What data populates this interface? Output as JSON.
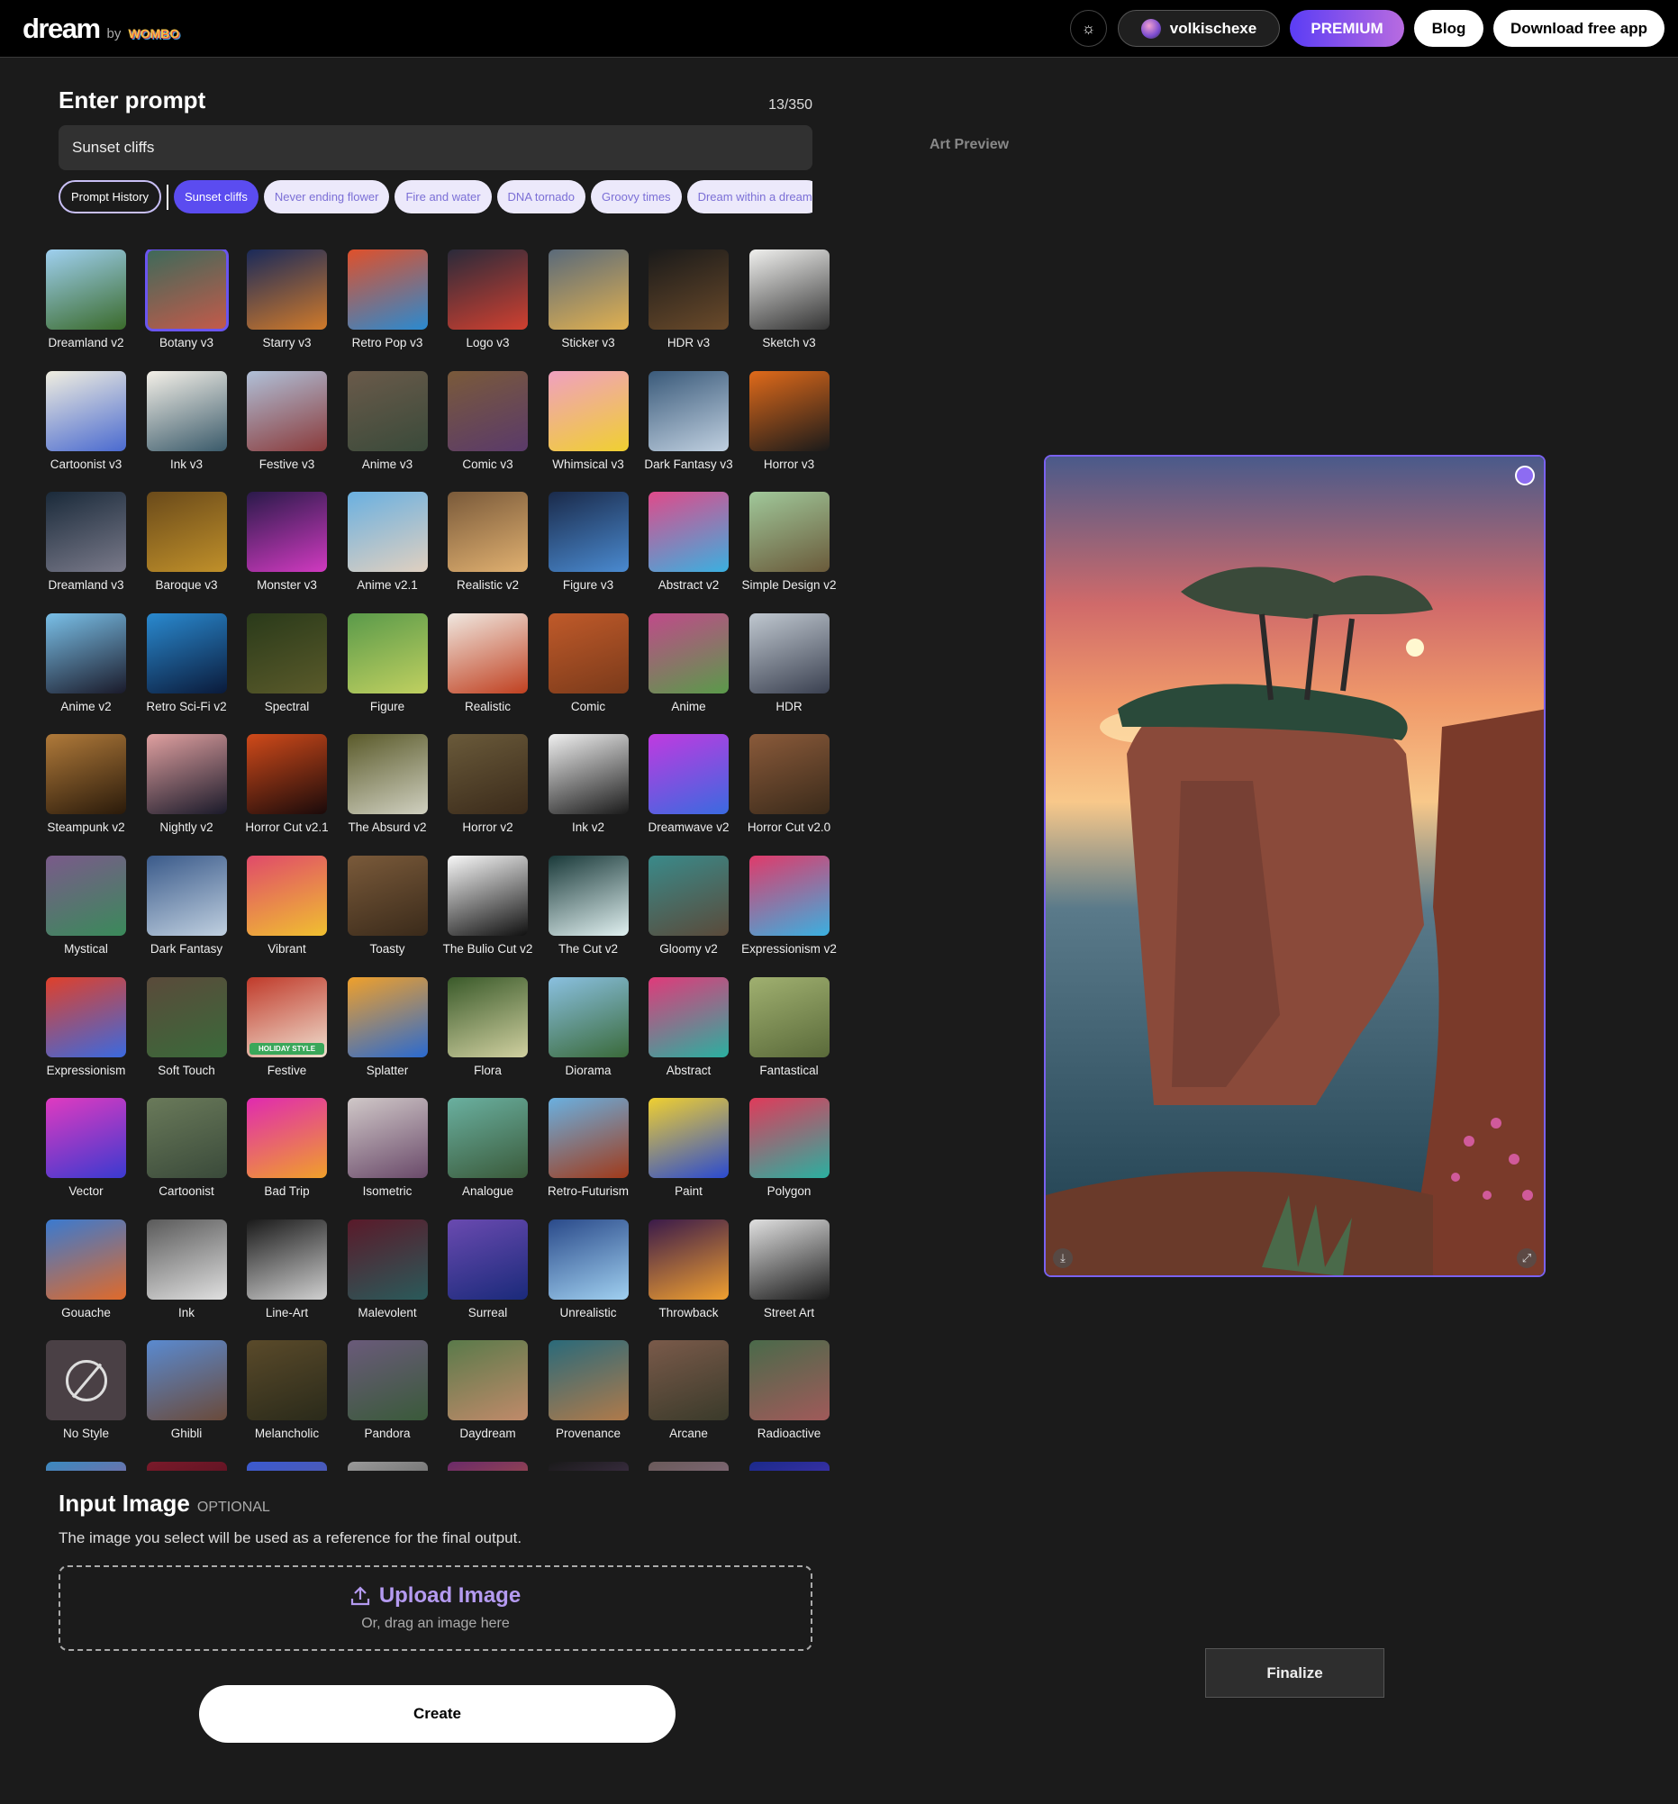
{
  "header": {
    "logo": "dream",
    "logo_by": "by",
    "logo_brand": "WOMBO",
    "username": "volkischexe",
    "premium": "PREMIUM",
    "blog": "Blog",
    "download": "Download free app"
  },
  "prompt": {
    "title": "Enter prompt",
    "counter": "13/350",
    "value": "Sunset cliffs",
    "history_label": "Prompt History",
    "chips": [
      "Sunset cliffs",
      "Never ending flower",
      "Fire and water",
      "DNA tornado",
      "Groovy times",
      "Dream within a dream"
    ],
    "active_chip": 0
  },
  "styles": {
    "selected": "Botany v3",
    "items": [
      {
        "label": "Dreamland v2",
        "c": [
          "#9fd0f0",
          "#3a6a2a"
        ]
      },
      {
        "label": "Botany v3",
        "c": [
          "#3d6a5a",
          "#c45a4a"
        ]
      },
      {
        "label": "Starry v3",
        "c": [
          "#1a2a5a",
          "#d07a2a"
        ]
      },
      {
        "label": "Retro Pop v3",
        "c": [
          "#e0502a",
          "#2a8ad0"
        ]
      },
      {
        "label": "Logo v3",
        "c": [
          "#2a2a3a",
          "#d04030"
        ]
      },
      {
        "label": "Sticker v3",
        "c": [
          "#5a6a7a",
          "#e0b050"
        ]
      },
      {
        "label": "HDR v3",
        "c": [
          "#1a1a1a",
          "#6a4a2a"
        ]
      },
      {
        "label": "Sketch v3",
        "c": [
          "#f0f0ee",
          "#333333"
        ]
      },
      {
        "label": "Cartoonist v3",
        "c": [
          "#f0eee0",
          "#4a6ad0"
        ]
      },
      {
        "label": "Ink v3",
        "c": [
          "#f4f0e8",
          "#3a5a6a"
        ]
      },
      {
        "label": "Festive v3",
        "c": [
          "#b0c0d8",
          "#8a3a3a"
        ]
      },
      {
        "label": "Anime v3",
        "c": [
          "#6a5a4a",
          "#3a4a3a"
        ]
      },
      {
        "label": "Comic v3",
        "c": [
          "#7a5a3a",
          "#5a3a6a"
        ]
      },
      {
        "label": "Whimsical v3",
        "c": [
          "#f0a0c0",
          "#f0d030"
        ]
      },
      {
        "label": "Dark Fantasy v3",
        "c": [
          "#3a5a7a",
          "#c0d0e0"
        ]
      },
      {
        "label": "Horror v3",
        "c": [
          "#e06a1a",
          "#1a1a1a"
        ]
      },
      {
        "label": "Dreamland v3",
        "c": [
          "#1a2a3a",
          "#7a7a8a"
        ]
      },
      {
        "label": "Baroque v3",
        "c": [
          "#6a4a1a",
          "#c0902a"
        ]
      },
      {
        "label": "Monster v3",
        "c": [
          "#2a1a4a",
          "#d03ac0"
        ]
      },
      {
        "label": "Anime v2.1",
        "c": [
          "#6ab0e0",
          "#e0d0c0"
        ]
      },
      {
        "label": "Realistic v2",
        "c": [
          "#7a5a3a",
          "#e0b070"
        ]
      },
      {
        "label": "Figure v3",
        "c": [
          "#1a2a4a",
          "#4a8ad0"
        ]
      },
      {
        "label": "Abstract v2",
        "c": [
          "#e04a8a",
          "#3ab0e0"
        ]
      },
      {
        "label": "Simple Design v2",
        "c": [
          "#a0c89a",
          "#6a5a3a"
        ]
      },
      {
        "label": "Anime v2",
        "c": [
          "#7ac0e8",
          "#1a1a2a"
        ]
      },
      {
        "label": "Retro Sci-Fi v2",
        "c": [
          "#2a8ad0",
          "#0a1a3a"
        ]
      },
      {
        "label": "Spectral",
        "c": [
          "#2a3a1a",
          "#5a5a2a"
        ]
      },
      {
        "label": "Figure",
        "c": [
          "#5a9a4a",
          "#c0d060"
        ]
      },
      {
        "label": "Realistic",
        "c": [
          "#f0e8e0",
          "#c04020"
        ]
      },
      {
        "label": "Comic",
        "c": [
          "#c05a2a",
          "#7a3a1a"
        ]
      },
      {
        "label": "Anime",
        "c": [
          "#c04a8a",
          "#5a9a4a"
        ]
      },
      {
        "label": "HDR",
        "c": [
          "#c0c8d0",
          "#3a4050"
        ]
      },
      {
        "label": "Steampunk v2",
        "c": [
          "#b07a3a",
          "#2a1a0a"
        ]
      },
      {
        "label": "Nightly v2",
        "c": [
          "#e0a0a0",
          "#1a1a2a"
        ]
      },
      {
        "label": "Horror Cut v2.1",
        "c": [
          "#d04a1a",
          "#1a0a0a"
        ]
      },
      {
        "label": "The Absurd v2",
        "c": [
          "#5a5a2a",
          "#d0d0c0"
        ]
      },
      {
        "label": "Horror v2",
        "c": [
          "#6a5a3a",
          "#3a2a1a"
        ]
      },
      {
        "label": "Ink v2",
        "c": [
          "#f0f0f0",
          "#1a1a1a"
        ]
      },
      {
        "label": "Dreamwave v2",
        "c": [
          "#c03ae0",
          "#3a6ae0"
        ]
      },
      {
        "label": "Horror Cut v2.0",
        "c": [
          "#8a5a3a",
          "#3a2a1a"
        ]
      },
      {
        "label": "Mystical",
        "c": [
          "#7a5a8a",
          "#3a8a5a"
        ]
      },
      {
        "label": "Dark Fantasy",
        "c": [
          "#3a5a8a",
          "#c0d0e0"
        ]
      },
      {
        "label": "Vibrant",
        "c": [
          "#e04a6a",
          "#f0c030"
        ]
      },
      {
        "label": "Toasty",
        "c": [
          "#7a5a3a",
          "#3a2a1a"
        ]
      },
      {
        "label": "The Bulio Cut v2",
        "c": [
          "#f8f8f8",
          "#101010"
        ]
      },
      {
        "label": "The Cut v2",
        "c": [
          "#1a3a3a",
          "#e0f0f0"
        ]
      },
      {
        "label": "Gloomy v2",
        "c": [
          "#3a8a8a",
          "#5a4a3a"
        ]
      },
      {
        "label": "Expressionism v2",
        "c": [
          "#e03a6a",
          "#3ab0e0"
        ]
      },
      {
        "label": "Expressionism",
        "c": [
          "#e0402a",
          "#3a6ae0"
        ]
      },
      {
        "label": "Soft Touch",
        "c": [
          "#5a4a3a",
          "#3a6a3a"
        ]
      },
      {
        "label": "Festive",
        "c": [
          "#c03a2a",
          "#f0e0d0"
        ],
        "badge": "HOLIDAY STYLE"
      },
      {
        "label": "Splatter",
        "c": [
          "#f0a02a",
          "#2a6ad0"
        ]
      },
      {
        "label": "Flora",
        "c": [
          "#3a5a2a",
          "#d0d0a0"
        ]
      },
      {
        "label": "Diorama",
        "c": [
          "#8ac0e0",
          "#3a6a3a"
        ]
      },
      {
        "label": "Abstract",
        "c": [
          "#e03a7a",
          "#2ab0a0"
        ]
      },
      {
        "label": "Fantastical",
        "c": [
          "#a0b070",
          "#5a6a3a"
        ]
      },
      {
        "label": "Vector",
        "c": [
          "#e03ac0",
          "#3a3ad0"
        ]
      },
      {
        "label": "Cartoonist",
        "c": [
          "#6a7a5a",
          "#3a4a3a"
        ]
      },
      {
        "label": "Bad Trip",
        "c": [
          "#e02ab0",
          "#f0a02a"
        ]
      },
      {
        "label": "Isometric",
        "c": [
          "#d0c8c8",
          "#6a4a6a"
        ]
      },
      {
        "label": "Analogue",
        "c": [
          "#6ab0a0",
          "#3a5a3a"
        ]
      },
      {
        "label": "Retro-Futurism",
        "c": [
          "#6ab0e0",
          "#a03a1a"
        ]
      },
      {
        "label": "Paint",
        "c": [
          "#f0d030",
          "#2a4ad0"
        ]
      },
      {
        "label": "Polygon",
        "c": [
          "#e03a5a",
          "#2ab0a0"
        ]
      },
      {
        "label": "Gouache",
        "c": [
          "#3a7ad0",
          "#e06a2a"
        ]
      },
      {
        "label": "Ink",
        "c": [
          "#5a5a5a",
          "#e0e0e0"
        ]
      },
      {
        "label": "Line-Art",
        "c": [
          "#1a1a1a",
          "#d0d0d0"
        ]
      },
      {
        "label": "Malevolent",
        "c": [
          "#5a1a2a",
          "#2a5a5a"
        ]
      },
      {
        "label": "Surreal",
        "c": [
          "#6a4ab0",
          "#1a2a7a"
        ]
      },
      {
        "label": "Unrealistic",
        "c": [
          "#2a4a8a",
          "#a0d0f0"
        ]
      },
      {
        "label": "Throwback",
        "c": [
          "#3a1a4a",
          "#f0a030"
        ]
      },
      {
        "label": "Street Art",
        "c": [
          "#e0e0e0",
          "#1a1a1a"
        ]
      },
      {
        "label": "No Style",
        "c": [
          "#4a4045",
          "#4a4045"
        ],
        "none": true
      },
      {
        "label": "Ghibli",
        "c": [
          "#5a8ad0",
          "#6a4a3a"
        ]
      },
      {
        "label": "Melancholic",
        "c": [
          "#5a4a2a",
          "#2a2a1a"
        ]
      },
      {
        "label": "Pandora",
        "c": [
          "#6a5a7a",
          "#3a5a3a"
        ]
      },
      {
        "label": "Daydream",
        "c": [
          "#5a7a4a",
          "#c08a6a"
        ]
      },
      {
        "label": "Provenance",
        "c": [
          "#2a6a7a",
          "#b07a4a"
        ]
      },
      {
        "label": "Arcane",
        "c": [
          "#7a5a4a",
          "#3a3a2a"
        ]
      },
      {
        "label": "Radioactive",
        "c": [
          "#4a6a4a",
          "#a05a5a"
        ]
      },
      {
        "label": "",
        "c": [
          "#3a8ac0",
          "#c04a8a"
        ]
      },
      {
        "label": "",
        "c": [
          "#7a1a2a",
          "#3a0a1a"
        ]
      },
      {
        "label": "",
        "c": [
          "#3a5ad0",
          "#6a5a8a"
        ]
      },
      {
        "label": "",
        "c": [
          "#9a9a9a",
          "#3a3a3a"
        ]
      },
      {
        "label": "",
        "c": [
          "#6a2a6a",
          "#d06a2a"
        ]
      },
      {
        "label": "",
        "c": [
          "#1a1a1a",
          "#6a4a7a"
        ]
      },
      {
        "label": "",
        "c": [
          "#6a5a5a",
          "#9a7a9a"
        ]
      },
      {
        "label": "",
        "c": [
          "#1a2a8a",
          "#6a3ad0"
        ]
      }
    ]
  },
  "input_image": {
    "title": "Input Image",
    "optional": "OPTIONAL",
    "description": "The image you select will be used as a reference for the final output.",
    "upload": "Upload Image",
    "drag": "Or, drag an image here"
  },
  "create": "Create",
  "preview": {
    "label": "Art Preview",
    "finalize": "Finalize"
  },
  "colors": {
    "accent": "#5b4cf0",
    "chip_bg": "#ece9fb",
    "upload_text": "#b49af0",
    "bg": "#1b1b1b"
  }
}
